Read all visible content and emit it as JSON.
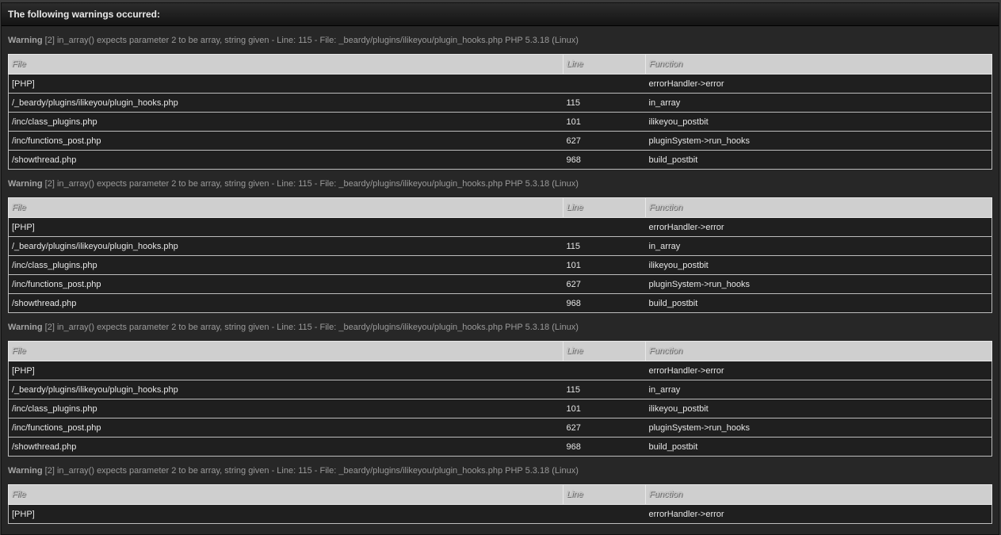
{
  "header": {
    "title": "The following warnings occurred:"
  },
  "columns": {
    "file": "File",
    "line": "Line",
    "function": "Function"
  },
  "warnings": [
    {
      "label": "Warning",
      "message": "[2] in_array() expects parameter 2 to be array, string given - Line: 115 - File: _beardy/plugins/ilikeyou/plugin_hooks.php PHP 5.3.18 (Linux)",
      "rows": [
        {
          "file": "[PHP]",
          "line": "",
          "function": "errorHandler->error"
        },
        {
          "file": "/_beardy/plugins/ilikeyou/plugin_hooks.php",
          "line": "115",
          "function": "in_array"
        },
        {
          "file": "/inc/class_plugins.php",
          "line": "101",
          "function": "ilikeyou_postbit"
        },
        {
          "file": "/inc/functions_post.php",
          "line": "627",
          "function": "pluginSystem->run_hooks"
        },
        {
          "file": "/showthread.php",
          "line": "968",
          "function": "build_postbit"
        }
      ]
    },
    {
      "label": "Warning",
      "message": "[2] in_array() expects parameter 2 to be array, string given - Line: 115 - File: _beardy/plugins/ilikeyou/plugin_hooks.php PHP 5.3.18 (Linux)",
      "rows": [
        {
          "file": "[PHP]",
          "line": "",
          "function": "errorHandler->error"
        },
        {
          "file": "/_beardy/plugins/ilikeyou/plugin_hooks.php",
          "line": "115",
          "function": "in_array"
        },
        {
          "file": "/inc/class_plugins.php",
          "line": "101",
          "function": "ilikeyou_postbit"
        },
        {
          "file": "/inc/functions_post.php",
          "line": "627",
          "function": "pluginSystem->run_hooks"
        },
        {
          "file": "/showthread.php",
          "line": "968",
          "function": "build_postbit"
        }
      ]
    },
    {
      "label": "Warning",
      "message": "[2] in_array() expects parameter 2 to be array, string given - Line: 115 - File: _beardy/plugins/ilikeyou/plugin_hooks.php PHP 5.3.18 (Linux)",
      "rows": [
        {
          "file": "[PHP]",
          "line": "",
          "function": "errorHandler->error"
        },
        {
          "file": "/_beardy/plugins/ilikeyou/plugin_hooks.php",
          "line": "115",
          "function": "in_array"
        },
        {
          "file": "/inc/class_plugins.php",
          "line": "101",
          "function": "ilikeyou_postbit"
        },
        {
          "file": "/inc/functions_post.php",
          "line": "627",
          "function": "pluginSystem->run_hooks"
        },
        {
          "file": "/showthread.php",
          "line": "968",
          "function": "build_postbit"
        }
      ]
    },
    {
      "label": "Warning",
      "message": "[2] in_array() expects parameter 2 to be array, string given - Line: 115 - File: _beardy/plugins/ilikeyou/plugin_hooks.php PHP 5.3.18 (Linux)",
      "rows": [
        {
          "file": "[PHP]",
          "line": "",
          "function": "errorHandler->error"
        }
      ]
    }
  ]
}
